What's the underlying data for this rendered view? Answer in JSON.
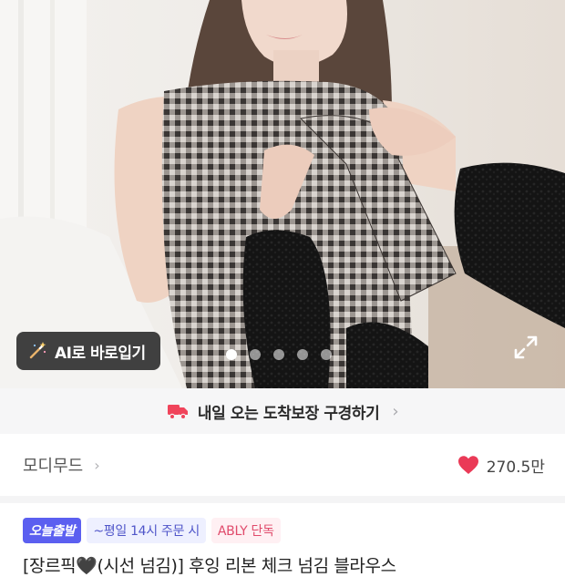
{
  "product_image": {
    "ai_try_on_label": "AI로 바로입기",
    "carousel_total": 5,
    "carousel_active_index": 0
  },
  "delivery": {
    "label": "내일 오는 도착보장 구경하기"
  },
  "brand": {
    "name": "모디무드",
    "like_count": "270.5만"
  },
  "tags": [
    {
      "label": "오늘출발"
    },
    {
      "label": "~평일 14시 주문 시"
    },
    {
      "label": "ABLY 단독"
    }
  ],
  "product": {
    "title_partial": "[장르픽🖤(시선 넘김)] 후잉 리본 체크 넘김 블라우스"
  },
  "colors": {
    "accent": "#5b5ff0",
    "heart": "#ea3a57",
    "delivery_icon": "#f0445b"
  }
}
